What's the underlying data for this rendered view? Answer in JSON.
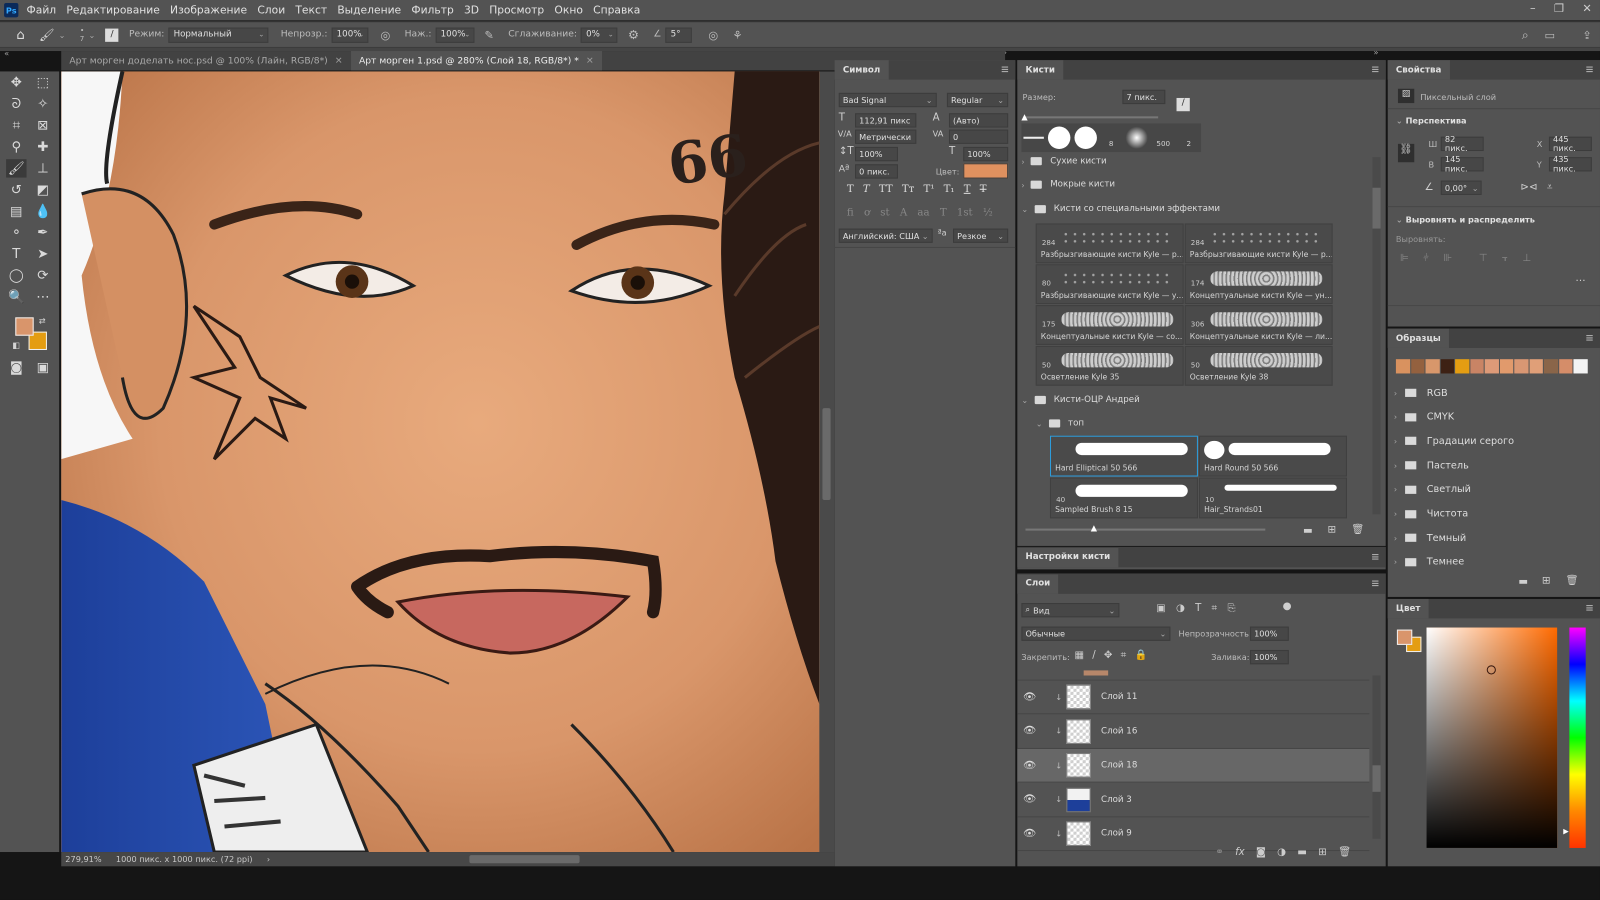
{
  "app": {
    "logo": "Ps"
  },
  "menu": [
    "Файл",
    "Редактирование",
    "Изображение",
    "Слои",
    "Текст",
    "Выделение",
    "Фильтр",
    "3D",
    "Просмотр",
    "Окно",
    "Справка"
  ],
  "options": {
    "brush_size": "7",
    "mode_label": "Режим:",
    "mode_value": "Нормальный",
    "opacity_label": "Непрозр.:",
    "opacity_value": "100%",
    "flow_label": "Наж.:",
    "flow_value": "100%",
    "smoothing_label": "Сглаживание:",
    "smoothing_value": "0%",
    "angle_value": "5°"
  },
  "tabs": [
    {
      "label": "Арт морген доделать нос.psd @ 100% (Лайн, RGB/8*)",
      "active": false
    },
    {
      "label": "Арт морген 1.psd @ 280% (Слой 18, RGB/8*) *",
      "active": true
    }
  ],
  "canvas": {
    "art_text": "66"
  },
  "status": {
    "zoom": "279,91%",
    "doc_size": "1000 пикс. x 1000 пикс. (72 ppi)"
  },
  "character": {
    "title": "Символ",
    "font": "Bad Signal",
    "style": "Regular",
    "size": "112,91 пикс",
    "leading": "(Авто)",
    "kerning": "Метрически",
    "tracking": "0",
    "vscale": "100%",
    "hscale": "100%",
    "baseline": "0 пикс.",
    "color_label": "Цвет:",
    "color": "#e0915f",
    "language": "Английский: США",
    "antialias": "Резкое"
  },
  "brushes": {
    "title": "Кисти",
    "size_label": "Размер:",
    "size_value": "7 пикс.",
    "presets": [
      "",
      "",
      "",
      "8",
      "",
      "500",
      "2"
    ],
    "folders": [
      "Сухие кисти",
      "Мокрые кисти",
      "Кисти со специальными эффектами"
    ],
    "effect_brushes": [
      {
        "num": "284",
        "name": "Разбрызгивающие кисти Kyle — р..."
      },
      {
        "num": "284",
        "name": "Разбрызгивающие кисти Kyle — р..."
      },
      {
        "num": "80",
        "name": "Разбрызгивающие кисти Kyle — у..."
      },
      {
        "num": "174",
        "name": "Концептуальные кисти Kyle — ун..."
      },
      {
        "num": "175",
        "name": "Концептуальные кисти Kyle — со..."
      },
      {
        "num": "306",
        "name": "Концептуальные кисти Kyle — ли..."
      },
      {
        "num": "50",
        "name": "Осветление Kyle 35"
      },
      {
        "num": "50",
        "name": "Осветление Kyle 38"
      }
    ],
    "custom_folder": "Кисти-ОЦР Андрей",
    "subfolder": "топ",
    "top_brushes": [
      {
        "num": "",
        "name": "Hard Elliptical 50 566",
        "selected": true
      },
      {
        "num": "",
        "name": "Hard Round 50 566",
        "selected": false
      },
      {
        "num": "40",
        "name": "Sampled Brush 8 15",
        "selected": false
      },
      {
        "num": "10",
        "name": "Hair_Strands01",
        "selected": false
      }
    ]
  },
  "brush_settings": {
    "title": "Настройки кисти"
  },
  "layers": {
    "title": "Слои",
    "filter": "Вид",
    "blend": "Обычные",
    "opacity_label": "Непрозрачность:",
    "opacity": "100%",
    "lock_label": "Закрепить:",
    "fill_label": "Заливка:",
    "fill": "100%",
    "items": [
      {
        "name": "Слой 11",
        "active": false
      },
      {
        "name": "Слой 16",
        "active": false
      },
      {
        "name": "Слой 18",
        "active": true
      },
      {
        "name": "Слой 3",
        "active": false
      },
      {
        "name": "Слой 9",
        "active": false
      }
    ]
  },
  "properties": {
    "title": "Свойства",
    "layer_type": "Пиксельный слой",
    "perspective": "Перспектива",
    "w_label": "Ш",
    "w": "82 пикс.",
    "h_label": "В",
    "h": "145 пикс.",
    "x_label": "X",
    "x": "445 пикс.",
    "y_label": "Y",
    "y": "435 пикс.",
    "angle": "0,00°",
    "align_section": "Выровнять и распределить",
    "align_label": "Выровнять:"
  },
  "swatches": {
    "title": "Образцы",
    "colors": [
      "#d9925f",
      "#94613f",
      "#d8976b",
      "#3d2114",
      "#e49d12",
      "#c98465",
      "#dd9a78",
      "#e19a6c",
      "#d99773",
      "#e09f78",
      "#8a6549",
      "#d58d69",
      "#f3f3f3"
    ],
    "groups": [
      "RGB",
      "CMYK",
      "Градации серого",
      "Пастель",
      "Светлый",
      "Чистота",
      "Темный",
      "Темнее"
    ]
  },
  "color": {
    "title": "Цвет",
    "foreground": "#d9956b",
    "background": "#e49d12",
    "hue": "#ff6a00"
  }
}
